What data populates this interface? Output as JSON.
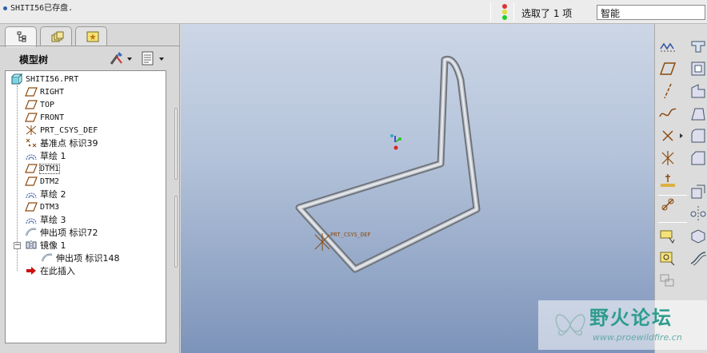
{
  "status": {
    "message": "SHITI56已存盘.",
    "selection_text": "选取了 1 项",
    "filter_value": "智能"
  },
  "left_panel": {
    "tabs": [
      "model-tree-icon",
      "layer-icon",
      "favorites-icon"
    ],
    "title": "模型树",
    "tree": [
      {
        "label": "SHITI56.PRT",
        "icon": "part-icon"
      },
      {
        "label": "RIGHT",
        "icon": "datum-plane-icon"
      },
      {
        "label": "TOP",
        "icon": "datum-plane-icon"
      },
      {
        "label": "FRONT",
        "icon": "datum-plane-icon"
      },
      {
        "label": "PRT_CSYS_DEF",
        "icon": "csys-icon"
      },
      {
        "label": "基准点 标识39",
        "icon": "datum-point-icon"
      },
      {
        "label": "草绘 1",
        "icon": "sketch-icon"
      },
      {
        "label": "DTM1",
        "icon": "datum-plane-icon"
      },
      {
        "label": "DTM2",
        "icon": "datum-plane-icon"
      },
      {
        "label": "草绘 2",
        "icon": "sketch-icon"
      },
      {
        "label": "DTM3",
        "icon": "datum-plane-icon"
      },
      {
        "label": "草绘 3",
        "icon": "sketch-icon"
      },
      {
        "label": "伸出项 标识72",
        "icon": "sweep-icon"
      },
      {
        "label": "镜像 1",
        "icon": "mirror-icon"
      },
      {
        "label": "伸出项 标识148",
        "icon": "sweep-icon"
      },
      {
        "label": "在此插入",
        "icon": "insert-arrow-icon"
      }
    ]
  },
  "viewport": {
    "csys_label": "PRT_CSYS_DEF"
  },
  "watermark": {
    "title": "野火论坛",
    "url": "www.proewildfire.cn"
  },
  "colors": {
    "viewport_top": "#ccd6e6",
    "viewport_bottom": "#7d94ba",
    "datum_icon": "#8a4a10",
    "insert_arrow": "#cc1111",
    "watermark": "#2f9c8e"
  }
}
